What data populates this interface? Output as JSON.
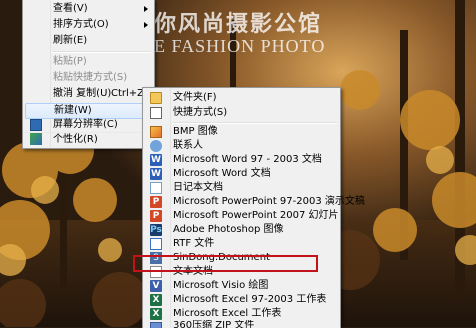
{
  "watermark": {
    "title_cn": "你风尚摄影公馆",
    "title_en": "E FASHION PHOTO"
  },
  "context_menu": {
    "items": [
      {
        "label": "查看(V)",
        "shortcut": "",
        "disabled": false,
        "has_submenu": true
      },
      {
        "label": "排序方式(O)",
        "shortcut": "",
        "disabled": false,
        "has_submenu": true
      },
      {
        "label": "刷新(E)",
        "shortcut": "",
        "disabled": false,
        "has_submenu": false
      },
      {
        "label": "粘贴(P)",
        "shortcut": "",
        "disabled": true,
        "has_submenu": false
      },
      {
        "label": "粘贴快捷方式(S)",
        "shortcut": "",
        "disabled": true,
        "has_submenu": false
      },
      {
        "label": "撤消 复制(U)",
        "shortcut": "Ctrl+Z",
        "disabled": false,
        "has_submenu": false
      },
      {
        "label": "新建(W)",
        "shortcut": "",
        "disabled": false,
        "has_submenu": true,
        "hover": true
      },
      {
        "label": "屏幕分辨率(C)",
        "shortcut": "",
        "disabled": false,
        "has_submenu": false,
        "icon": "screen-resolution-icon"
      },
      {
        "label": "个性化(R)",
        "shortcut": "",
        "disabled": false,
        "has_submenu": false,
        "icon": "personalize-icon"
      }
    ]
  },
  "new_submenu": {
    "items": [
      {
        "label": "文件夹(F)",
        "icon": "folder-icon"
      },
      {
        "label": "快捷方式(S)",
        "icon": "shortcut-icon"
      },
      {
        "label": "BMP 图像",
        "icon": "bmp-image-icon"
      },
      {
        "label": "联系人",
        "icon": "contact-icon"
      },
      {
        "label": "Microsoft Word 97 - 2003 文档",
        "icon": "word-icon"
      },
      {
        "label": "Microsoft Word 文档",
        "icon": "word-icon"
      },
      {
        "label": "日记本文档",
        "icon": "journal-icon"
      },
      {
        "label": "Microsoft PowerPoint 97-2003 演示文稿",
        "icon": "powerpoint-icon"
      },
      {
        "label": "Microsoft PowerPoint 2007 幻灯片",
        "icon": "powerpoint-icon"
      },
      {
        "label": "Adobe Photoshop 图像",
        "icon": "photoshop-icon"
      },
      {
        "label": "RTF 文件",
        "icon": "rtf-document-icon"
      },
      {
        "label": "SinDong.Document",
        "icon": "sindong-document-icon"
      },
      {
        "label": "文本文档",
        "icon": "text-document-icon",
        "highlighted": true
      },
      {
        "label": "Microsoft Visio 绘图",
        "icon": "visio-icon"
      },
      {
        "label": "Microsoft Excel 97-2003 工作表",
        "icon": "excel-icon"
      },
      {
        "label": "Microsoft Excel 工作表",
        "icon": "excel-icon"
      },
      {
        "label": "360压缩 ZIP 文件",
        "icon": "zip-archive-icon"
      }
    ]
  },
  "icon_glyphs": {
    "word": "W",
    "powerpoint": "P",
    "photoshop": "Ps",
    "visio": "V",
    "excel": "X",
    "sindong": "S"
  },
  "colors": {
    "highlight_border": "#c4121b",
    "menu_background": "#f0f0f0",
    "hover_background": "#dcebfc"
  }
}
